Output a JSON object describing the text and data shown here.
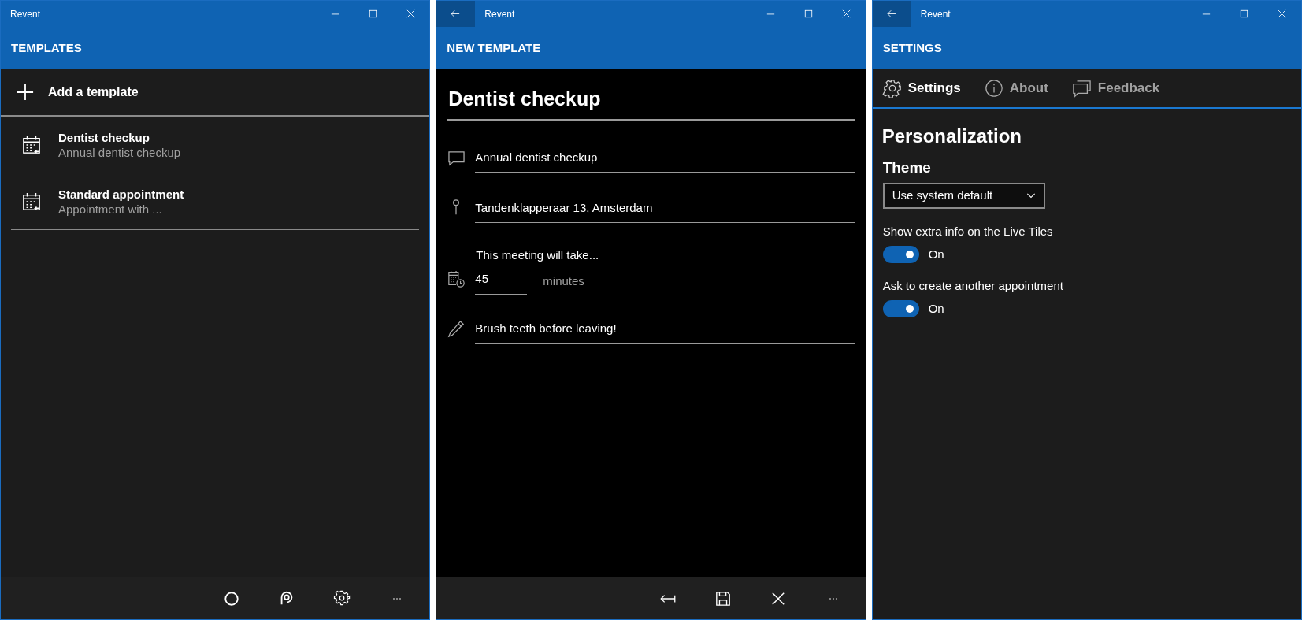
{
  "windows": [
    {
      "kind": "templates",
      "title": "Revent",
      "back_button": false,
      "header": "TEMPLATES",
      "add_button": "Add a template",
      "templates": [
        {
          "title": "Dentist checkup",
          "subtitle": "Annual dentist checkup"
        },
        {
          "title": "Standard appointment",
          "subtitle": "Appointment with ..."
        }
      ],
      "commands": [
        {
          "kind": "circle"
        },
        {
          "kind": "logo"
        },
        {
          "kind": "settings"
        },
        {
          "kind": "more"
        }
      ]
    },
    {
      "kind": "editor",
      "title": "Revent",
      "back_button": true,
      "header": "NEW TEMPLATE",
      "name_field": "Dentist checkup",
      "fields": [
        {
          "kind": "description",
          "value": "Annual dentist checkup"
        },
        {
          "kind": "location",
          "value": "Tandenklapperaar 13, Amsterdam"
        },
        {
          "kind": "duration",
          "label": "This meeting will take...",
          "value": "45",
          "unit": "minutes"
        },
        {
          "kind": "notes",
          "value": "Brush teeth before leaving!"
        }
      ],
      "commands": [
        {
          "kind": "back"
        },
        {
          "kind": "save"
        },
        {
          "kind": "close"
        },
        {
          "kind": "more"
        }
      ]
    },
    {
      "kind": "settings",
      "title": "Revent",
      "back_button": true,
      "header": "SETTINGS",
      "tabs": [
        {
          "kind": "settings",
          "label": "Settings",
          "selected": true
        },
        {
          "kind": "about",
          "label": "About",
          "selected": false
        },
        {
          "kind": "feedback",
          "label": "Feedback",
          "selected": false
        }
      ],
      "section": "Personalization",
      "theme_label": "Theme",
      "theme_value": "Use system default",
      "toggles": [
        {
          "label": "Show extra info on the Live Tiles",
          "on": true,
          "state": "On"
        },
        {
          "label": "Ask to create another appointment",
          "on": true,
          "state": "On"
        }
      ]
    }
  ]
}
